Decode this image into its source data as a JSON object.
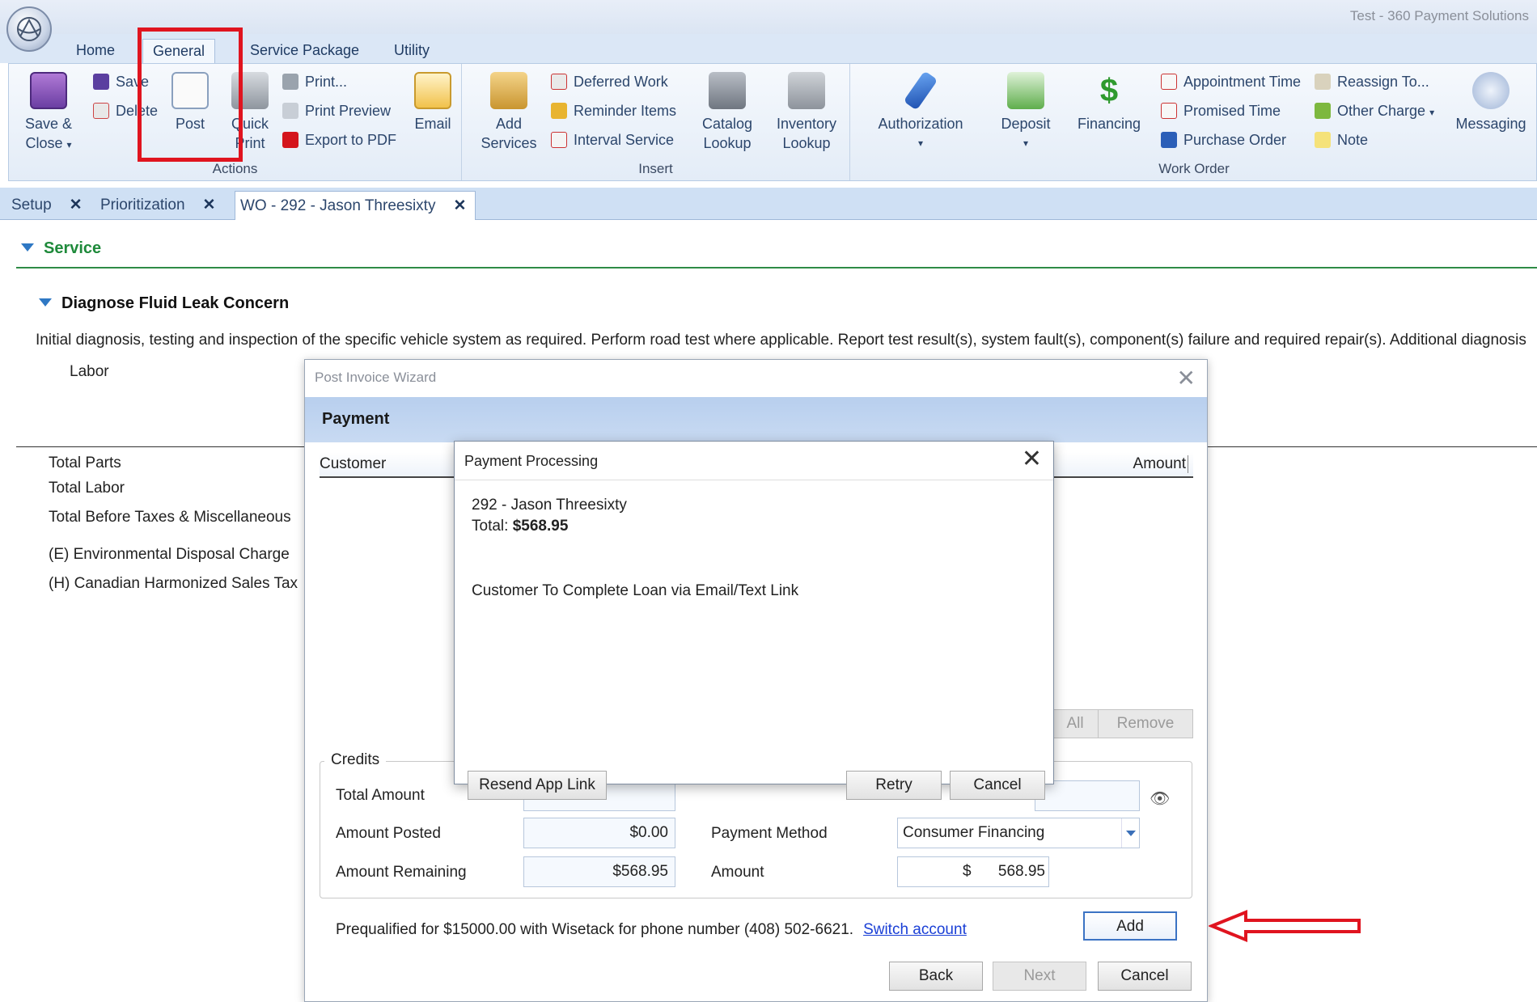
{
  "window": {
    "title": "Test - 360 Payment Solutions"
  },
  "ribbon": {
    "tabs": [
      {
        "label": "Home"
      },
      {
        "label": "General"
      },
      {
        "label": "Service Package"
      },
      {
        "label": "Utility"
      }
    ],
    "actions": {
      "label": "Actions",
      "save_close": "Save &",
      "save_close_2": "Close",
      "save": "Save",
      "delete": "Delete",
      "post": "Post",
      "quick_print": "Quick",
      "quick_print_2": "Print",
      "print": "Print...",
      "print_preview": "Print Preview",
      "export_pdf": "Export to PDF",
      "email": "Email"
    },
    "insert": {
      "label": "Insert",
      "add_services": "Add",
      "add_services_2": "Services",
      "deferred_work": "Deferred Work",
      "reminder_items": "Reminder Items",
      "interval_service": "Interval Service",
      "catalog_lookup": "Catalog",
      "catalog_lookup_2": "Lookup",
      "inventory_lookup": "Inventory",
      "inventory_lookup_2": "Lookup"
    },
    "work_order": {
      "label": "Work Order",
      "authorization": "Authorization",
      "deposit": "Deposit",
      "financing": "Financing",
      "appointment_time": "Appointment Time",
      "promised_time": "Promised Time",
      "purchase_order": "Purchase Order",
      "reassign_to": "Reassign To...",
      "other_charge": "Other Charge",
      "note": "Note",
      "messaging": "Messaging"
    }
  },
  "doc_tabs": [
    {
      "label": "Setup"
    },
    {
      "label": "Prioritization"
    },
    {
      "label": "WO - 292 - Jason Threesixty"
    }
  ],
  "workorder": {
    "section": "Service",
    "job_title": "Diagnose Fluid Leak Concern",
    "job_description": "Initial diagnosis, testing and inspection of the specific vehicle system as required.  Perform road test where applicable.  Report test result(s), system fault(s), component(s) failure and required repair(s).  Additional diagnosis",
    "labor_label": "Labor",
    "totals": [
      "Total Parts",
      "Total Labor",
      "Total Before Taxes & Miscellaneous",
      "(E) Environmental Disposal Charge",
      "(H) Canadian Harmonized Sales Tax"
    ]
  },
  "wizard": {
    "title": "Post Invoice Wizard",
    "header": "Payment",
    "grid_columns": {
      "customer": "Customer",
      "amount": "Amount"
    },
    "remove_all": "All",
    "remove": "Remove",
    "credits_label": "Credits",
    "total_amount_label": "Total Amount",
    "amount_posted_label": "Amount Posted",
    "amount_posted": "$0.00",
    "amount_remaining_label": "Amount Remaining",
    "amount_remaining": "$568.95",
    "payment_method_label": "Payment Method",
    "payment_method": "Consumer Financing",
    "amount_label": "Amount",
    "amount_currency": "$",
    "amount_value": "568.95",
    "prequal_text": "Prequalified for $15000.00 with Wisetack for phone number (408) 502-6621.",
    "switch_account": "Switch account",
    "add": "Add",
    "back": "Back",
    "next": "Next",
    "cancel": "Cancel"
  },
  "payment_processing": {
    "title": "Payment Processing",
    "customer": "292 - Jason Threesixty",
    "total_label": "Total:",
    "total_value": "$568.95",
    "message": "Customer To Complete Loan via Email/Text Link",
    "resend": "Resend App Link",
    "retry": "Retry",
    "cancel": "Cancel"
  },
  "colors": {
    "annotation_red": "#e0141f",
    "service_green": "#1f8a3b",
    "link_blue": "#1a3fd6",
    "wizard_header": "#b8cfee"
  },
  "icons": [
    "app-logo-icon",
    "save-close-icon",
    "save-icon",
    "delete-icon",
    "post-icon",
    "quick-print-icon",
    "print-icon",
    "print-preview-icon",
    "pdf-icon",
    "email-icon",
    "add-services-icon",
    "deferred-work-icon",
    "reminder-icon",
    "interval-icon",
    "catalog-icon",
    "inventory-icon",
    "authorization-icon",
    "deposit-icon",
    "financing-icon",
    "calendar-icon",
    "reassign-icon",
    "other-charge-icon",
    "note-icon",
    "messaging-icon",
    "close-icon",
    "eye-icon"
  ]
}
